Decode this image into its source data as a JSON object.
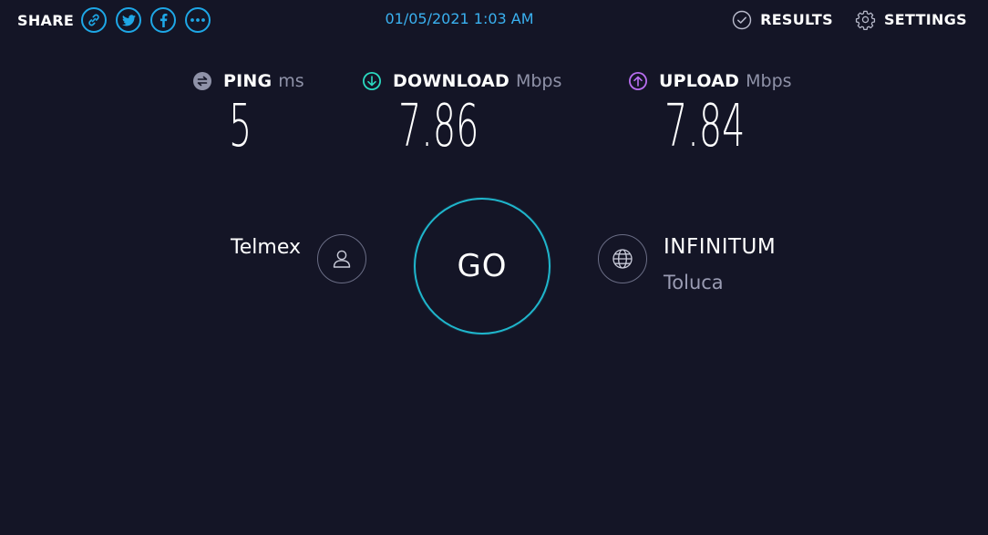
{
  "share": {
    "label": "SHARE",
    "buttons": [
      {
        "icon": "link-icon"
      },
      {
        "icon": "twitter-icon"
      },
      {
        "icon": "facebook-icon"
      },
      {
        "icon": "more-icon"
      }
    ]
  },
  "datetime": "01/05/2021 1:03 AM",
  "nav": {
    "results_label": "RESULTS",
    "settings_label": "SETTINGS"
  },
  "metrics": {
    "ping": {
      "label": "PING",
      "unit": "ms",
      "value": "5",
      "icon": "ping-icon"
    },
    "download": {
      "label": "DOWNLOAD",
      "unit": "Mbps",
      "value": "7.86",
      "icon": "download-icon"
    },
    "upload": {
      "label": "UPLOAD",
      "unit": "Mbps",
      "value": "7.84",
      "icon": "upload-icon"
    }
  },
  "isp": {
    "name": "Telmex",
    "icon": "user-icon"
  },
  "go_button": {
    "label": "GO"
  },
  "server": {
    "name": "INFINITUM",
    "location": "Toluca",
    "icon": "globe-icon"
  },
  "colors": {
    "background": "#141526",
    "accent_blue": "#1ea7e6",
    "go_ring": "#1fb6cc",
    "download_accent": "#2bd9c0",
    "upload_accent": "#b86ef0",
    "muted": "#8f92a8"
  }
}
